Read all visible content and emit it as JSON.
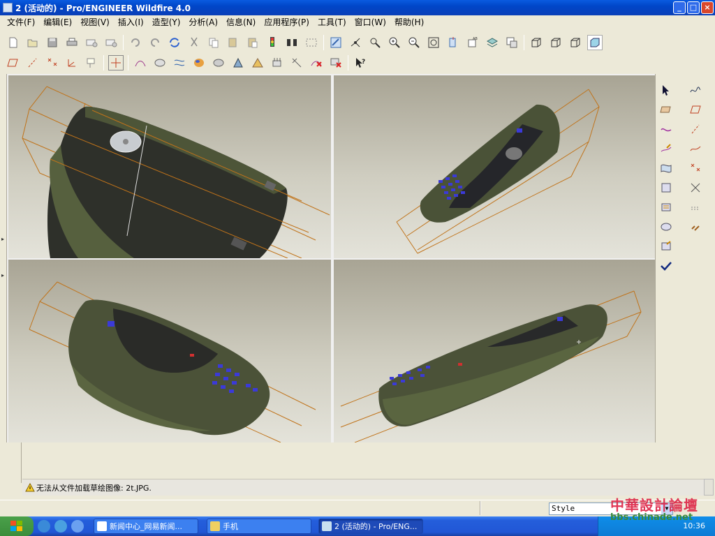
{
  "window": {
    "title": "2 (活动的) - Pro/ENGINEER Wildfire 4.0",
    "buttons": {
      "minimize": "_",
      "maximize": "□",
      "close": "×"
    }
  },
  "menu": [
    "文件(F)",
    "编辑(E)",
    "视图(V)",
    "插入(I)",
    "造型(Y)",
    "分析(A)",
    "信息(N)",
    "应用程序(P)",
    "工具(T)",
    "窗口(W)",
    "帮助(H)"
  ],
  "toolbar_icons": {
    "row1": [
      "new-icon",
      "open-icon",
      "save-icon",
      "print-icon",
      "email-icon",
      "email-link-icon",
      "undo-icon",
      "redo-icon",
      "regenerate-icon",
      "cut-icon",
      "copy-icon",
      "paste-icon",
      "paste-special-icon",
      "traffic-light-icon",
      "binoculars-icon",
      "select-box-icon",
      "repaint-icon",
      "spin-center-icon",
      "orient-icon",
      "zoom-in-icon",
      "zoom-out-icon",
      "refit-icon",
      "orientation-icon",
      "saved-views-icon",
      "layers-icon",
      "view-manager-icon",
      "wireframe-icon",
      "hidden-line-icon",
      "no-hidden-icon",
      "shading-icon"
    ],
    "row2": [
      "datum-plane-icon",
      "datum-axis-icon",
      "datum-point-icon",
      "coordinate-system-icon",
      "annotation-icon",
      "grid-icon",
      "curve-analysis-icon",
      "surface-analysis-icon",
      "reflection-icon",
      "shade-analysis-icon",
      "draft-icon",
      "slope-icon",
      "curvature-icon",
      "offset-icon",
      "delete-analysis-icon",
      "hide-analysis-icon",
      "whats-this-icon"
    ]
  },
  "right_tools": [
    "select-arrow-icon",
    "curve-icon",
    "sketch-plane-icon",
    "datum-plane-icon",
    "free-curve-icon",
    "axis-line-icon",
    "pencil-curve-icon",
    "spline-icon",
    "surface-icon",
    "point-icon",
    "boundary-surface-icon",
    "trim-icon",
    "blend-icon",
    "offset-icon",
    "fill-surface-icon",
    "link-icon",
    "edit-surface-icon",
    "done-check-icon"
  ],
  "message": {
    "text": "无法从文件加载草绘图像: 2t.JPG."
  },
  "status": {
    "style_value": "Style"
  },
  "taskbar": {
    "tasks": [
      {
        "label": "新闻中心_网易新闻..."
      },
      {
        "label": "手机"
      },
      {
        "label": "2 (活动的) - Pro/ENG..."
      }
    ],
    "clock": "10:36"
  },
  "watermark": {
    "cn": "中華設計論壇",
    "url": "bbs.chinade.net"
  },
  "colors": {
    "titlebar": "#0a5be0",
    "viewport_bg_top": "#a8a494",
    "viewport_bg_bottom": "#e4e3da",
    "phone_body": "#4b5238",
    "phone_dark": "#2a2a26",
    "keypad": "#3b3ad8",
    "boundary_lines": "#c0731a",
    "taskbar": "#245edb"
  }
}
